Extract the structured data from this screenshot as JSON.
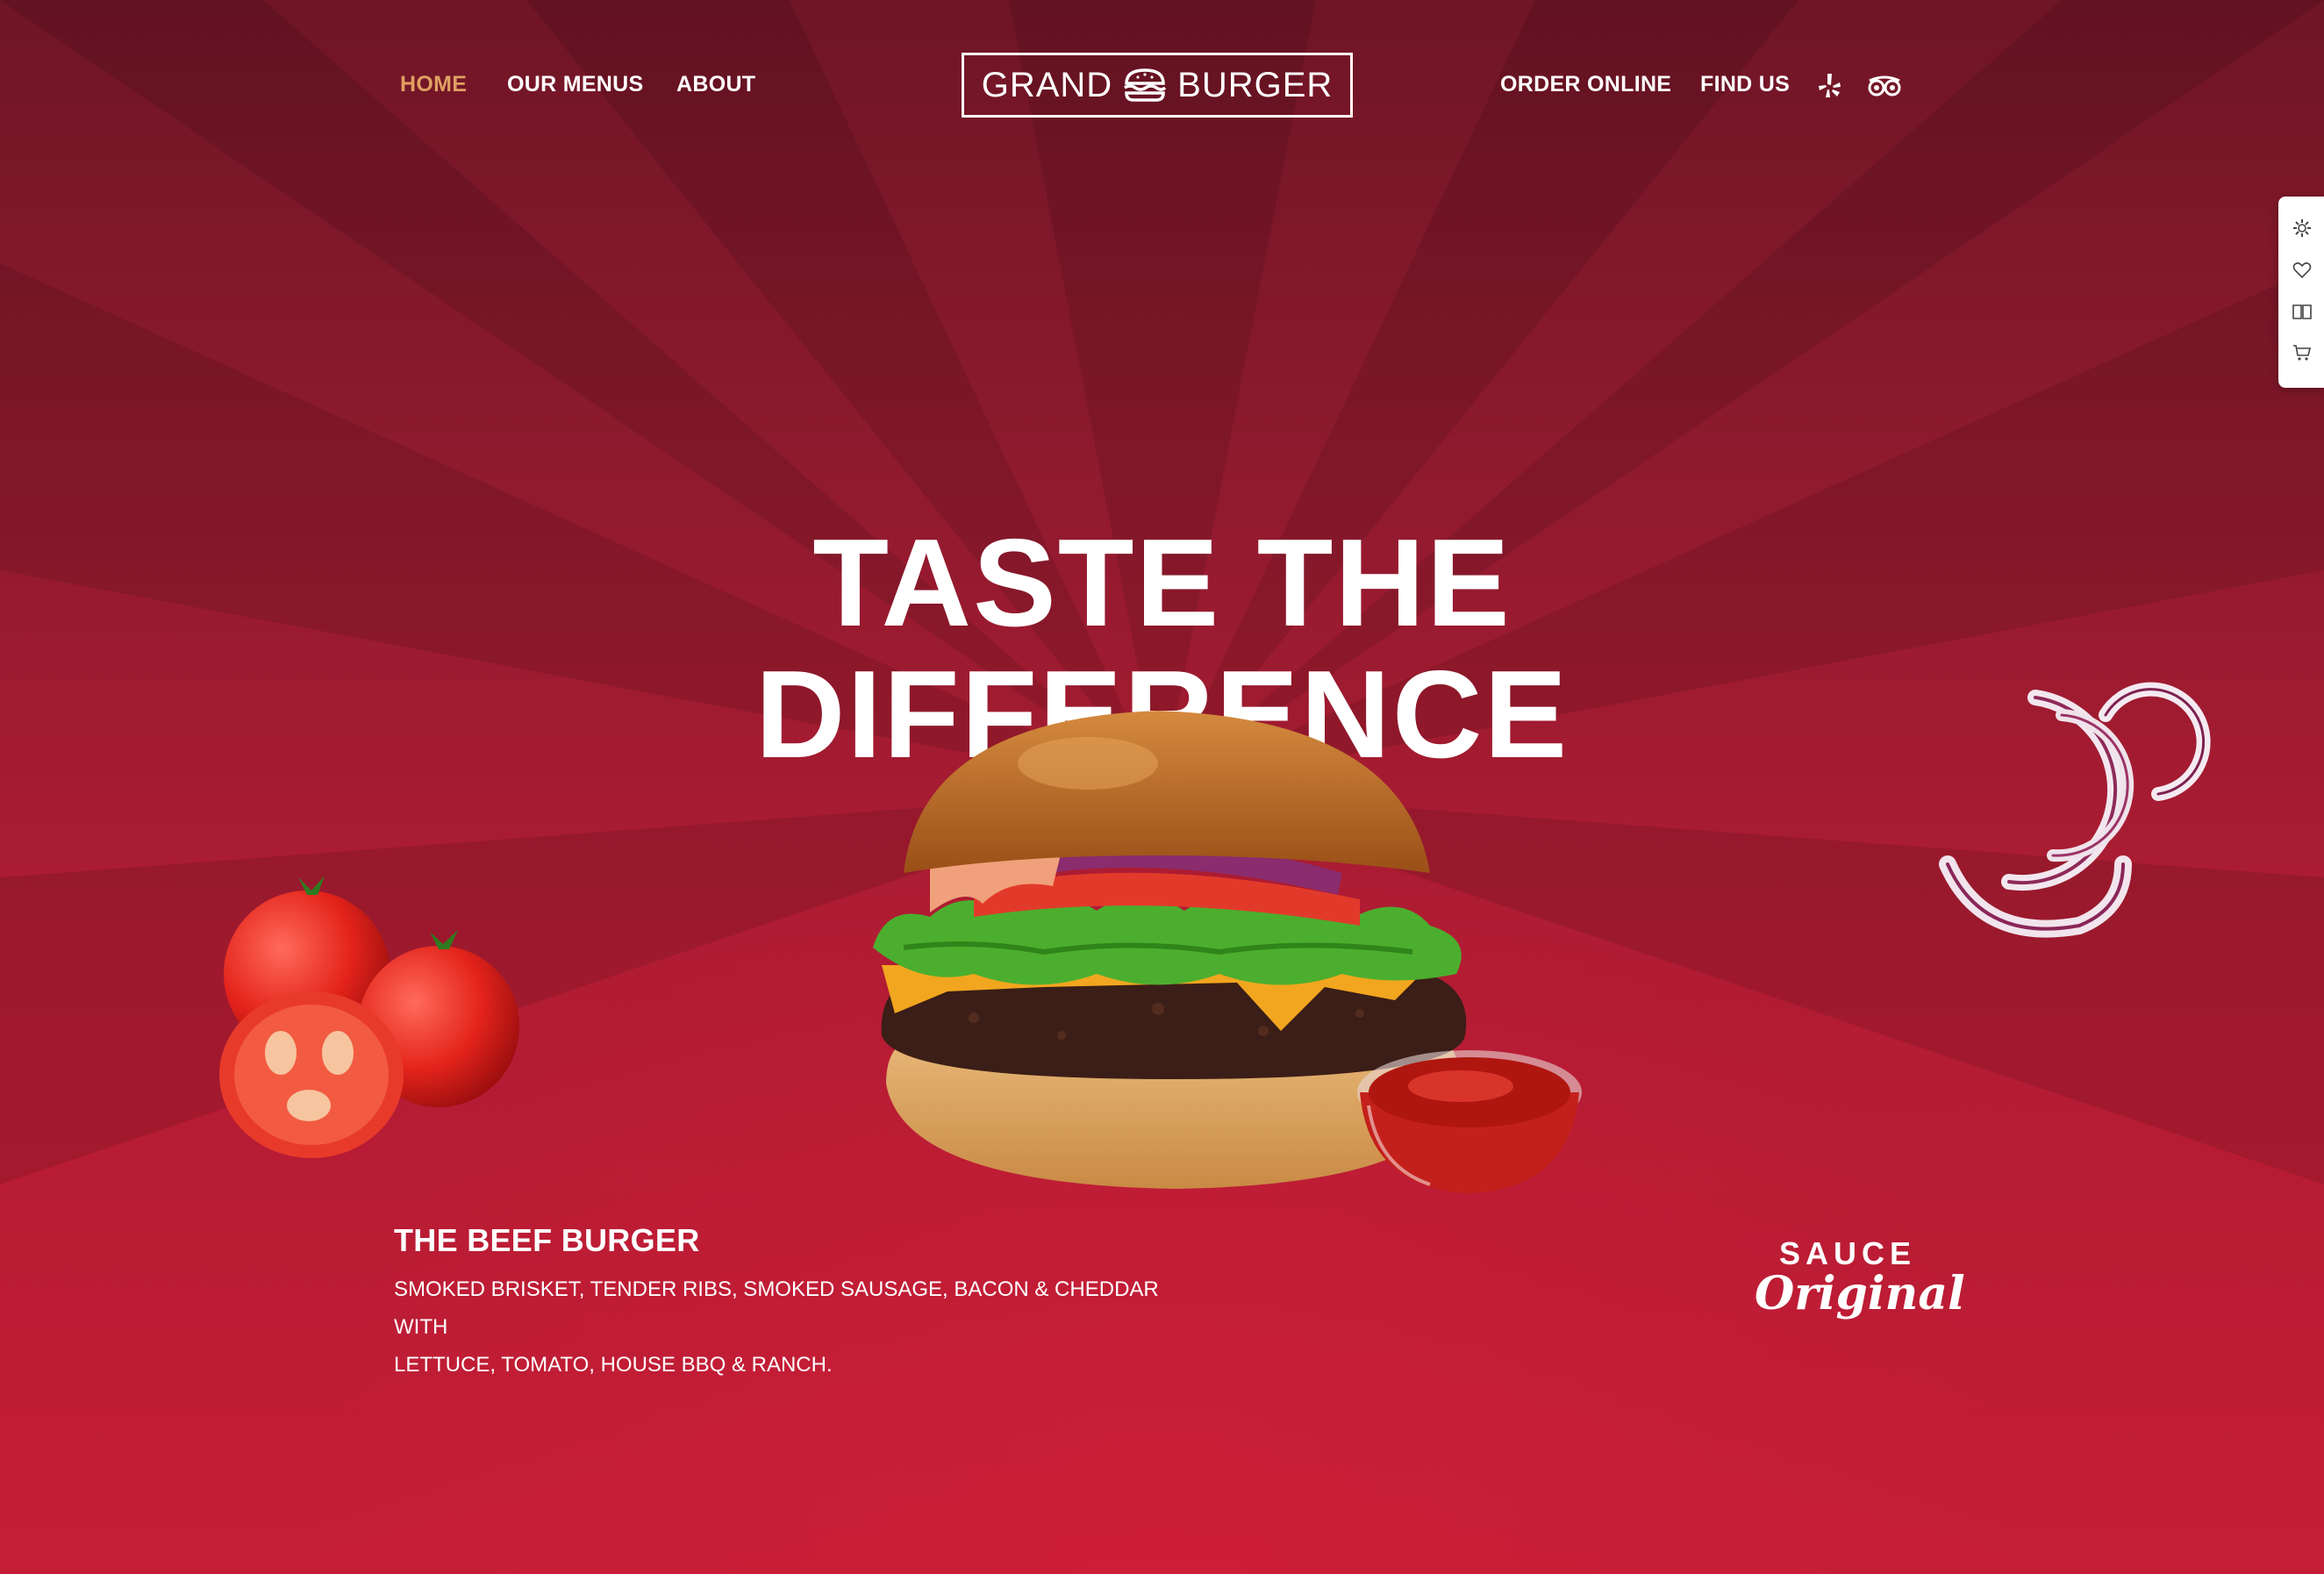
{
  "nav": {
    "left": [
      {
        "label": "HOME",
        "active": true
      },
      {
        "label": "OUR MENUS",
        "active": false
      },
      {
        "label": "ABOUT",
        "active": false
      }
    ],
    "logo": {
      "word_left": "GRAND",
      "word_right": "BURGER"
    },
    "right": [
      {
        "label": "ORDER ONLINE"
      },
      {
        "label": "FIND US"
      }
    ],
    "social_icons": [
      "yelp-icon",
      "tripadvisor-icon"
    ]
  },
  "side_panel": {
    "icons": [
      "gear-icon",
      "heart-icon",
      "book-icon",
      "cart-icon"
    ]
  },
  "hero": {
    "title_line1": "TASTE THE",
    "title_line2": "DIFFERENCE"
  },
  "product": {
    "title": "THE BEEF BURGER",
    "desc_line1": "SMOKED BRISKET, TENDER RIBS, SMOKED SAUSAGE, BACON & CHEDDAR WITH",
    "desc_line2": "LETTUCE, TOMATO, HOUSE BBQ & RANCH."
  },
  "badge": {
    "line1": "SAUCE",
    "line2": "Original"
  },
  "colors": {
    "accent_active": "#e0a062",
    "background_top": "#6e1526",
    "background_bottom": "#c51d36",
    "text": "#ffffff"
  }
}
